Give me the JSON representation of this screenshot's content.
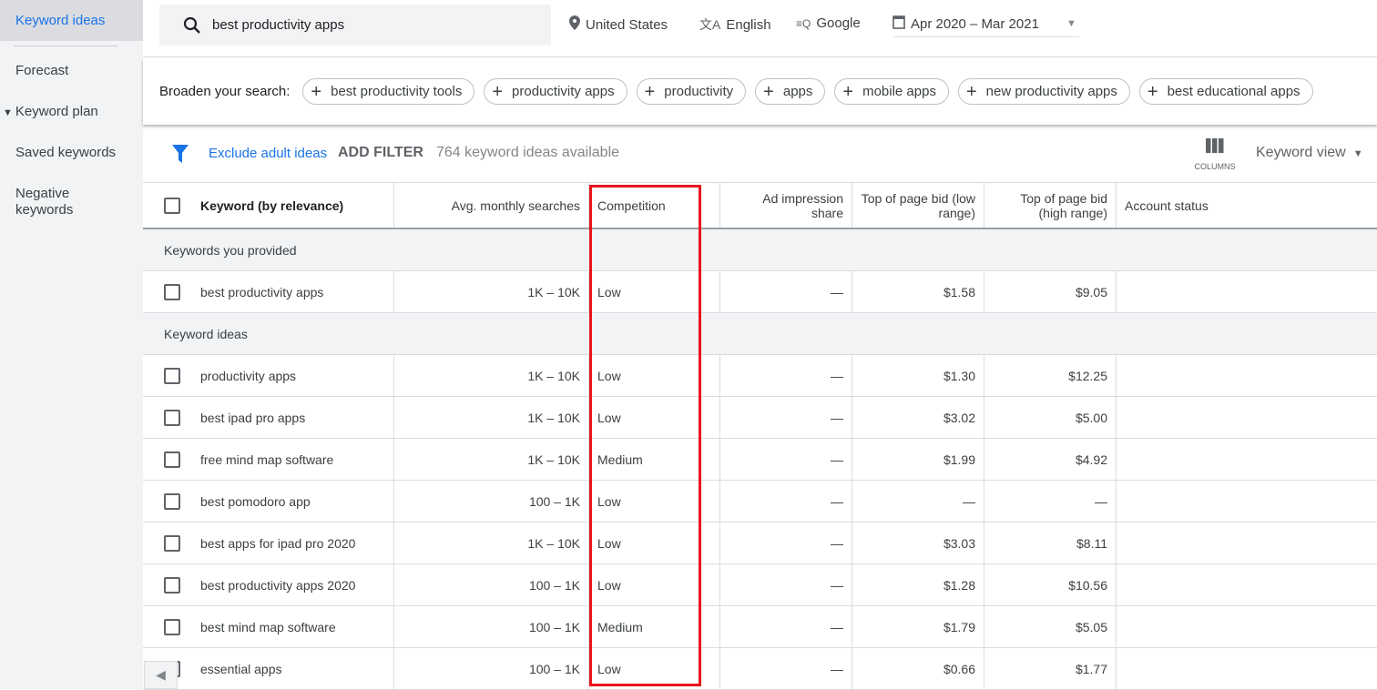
{
  "sidebar": {
    "items": [
      {
        "label": "Keyword ideas",
        "active": true
      },
      {
        "label": "Forecast"
      },
      {
        "label": "Keyword plan"
      },
      {
        "label": "Saved keywords"
      },
      {
        "label": "Negative keywords"
      }
    ]
  },
  "topbar": {
    "search_value": "best productivity apps",
    "location": "United States",
    "language": "English",
    "network": "Google",
    "date_range": "Apr 2020 – Mar 2021"
  },
  "broaden": {
    "label": "Broaden your search:",
    "chips": [
      "best productivity tools",
      "productivity apps",
      "productivity",
      "apps",
      "mobile apps",
      "new productivity apps",
      "best educational apps"
    ]
  },
  "filterbar": {
    "exclude": "Exclude adult ideas",
    "add_filter": "ADD FILTER",
    "count": "764 keyword ideas available",
    "columns": "COLUMNS",
    "view": "Keyword view"
  },
  "table": {
    "headers": [
      "Keyword (by relevance)",
      "Avg. monthly searches",
      "Competition",
      "Ad impression share",
      "Top of page bid (low range)",
      "Top of page bid (high range)",
      "Account status"
    ],
    "groups": [
      {
        "label": "Keywords you provided",
        "rows": [
          [
            "best productivity apps",
            "1K – 10K",
            "Low",
            "—",
            "$1.58",
            "$9.05"
          ]
        ]
      },
      {
        "label": "Keyword ideas",
        "rows": [
          [
            "productivity apps",
            "1K – 10K",
            "Low",
            "—",
            "$1.30",
            "$12.25"
          ],
          [
            "best ipad pro apps",
            "1K – 10K",
            "Low",
            "—",
            "$3.02",
            "$5.00"
          ],
          [
            "free mind map software",
            "1K – 10K",
            "Medium",
            "—",
            "$1.99",
            "$4.92"
          ],
          [
            "best pomodoro app",
            "100 – 1K",
            "Low",
            "—",
            "—",
            "—"
          ],
          [
            "best apps for ipad pro 2020",
            "1K – 10K",
            "Low",
            "—",
            "$3.03",
            "$8.11"
          ],
          [
            "best productivity apps 2020",
            "100 – 1K",
            "Low",
            "—",
            "$1.28",
            "$10.56"
          ],
          [
            "best mind map software",
            "100 – 1K",
            "Medium",
            "—",
            "$1.79",
            "$5.05"
          ],
          [
            "essential apps",
            "100 – 1K",
            "Low",
            "—",
            "$0.66",
            "$1.77"
          ]
        ]
      }
    ]
  },
  "colors": {
    "accent": "#1a73e8",
    "highlight": "#e8141c"
  }
}
